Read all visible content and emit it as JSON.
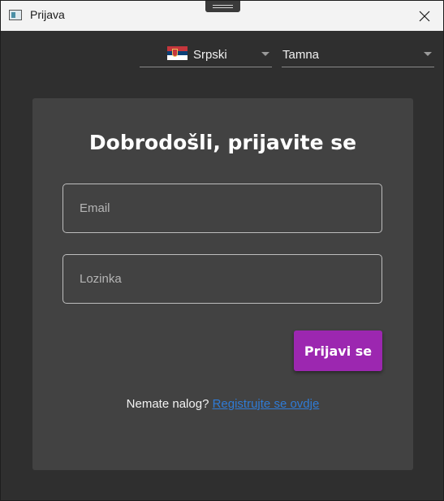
{
  "window": {
    "title": "Prijava"
  },
  "toolbar": {
    "language": {
      "selected": "Srpski",
      "flag_icon": "serbia-flag-icon"
    },
    "theme": {
      "selected": "Tamna"
    }
  },
  "login": {
    "heading": "Dobrodošli, prijavite se",
    "email_placeholder": "Email",
    "password_placeholder": "Lozinka",
    "submit_label": "Prijavi se",
    "no_account_text": "Nemate nalog?",
    "register_link": "Registrujte se ovdje"
  },
  "colors": {
    "accent": "#9c27b0",
    "link": "#2f7bd6",
    "card_background": "#424242",
    "window_background": "#2f2f2f"
  }
}
